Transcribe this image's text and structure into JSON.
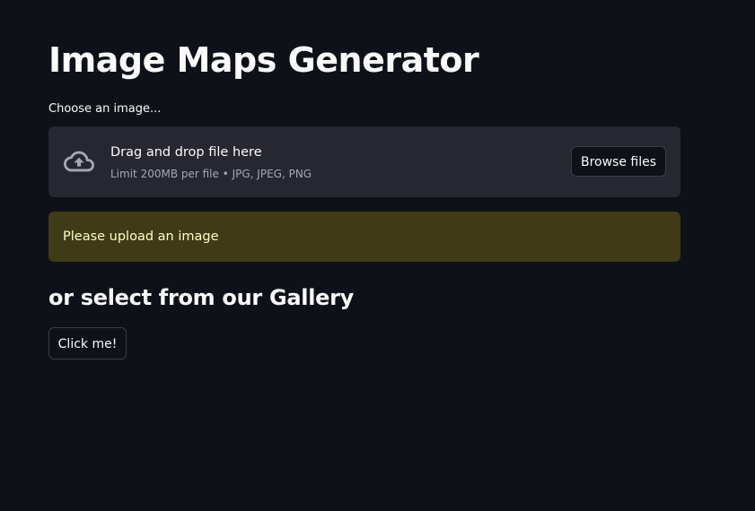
{
  "page": {
    "title": "Image Maps Generator"
  },
  "uploader": {
    "label": "Choose an image...",
    "dropzone_title": "Drag and drop file here",
    "limit_text": "Limit 200MB per file • JPG, JPEG, PNG",
    "browse_label": "Browse files",
    "icon": "cloud-upload-icon"
  },
  "warning": {
    "text": "Please upload an image"
  },
  "gallery": {
    "heading": "or select from our Gallery",
    "button_label": "Click me!"
  },
  "colors": {
    "background": "#0e1117",
    "dropzone": "#262730",
    "warning_bg": "#3e3b16",
    "warning_text": "#ffffc2",
    "text": "#fafafa",
    "muted": "#a3a8b8"
  }
}
